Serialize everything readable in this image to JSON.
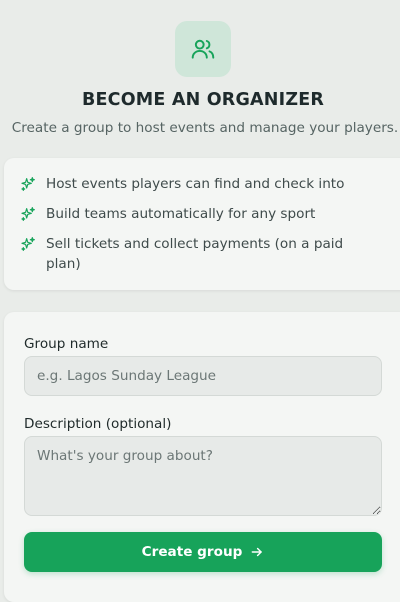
{
  "header": {
    "icon": "users-icon",
    "title": "BECOME AN ORGANIZER",
    "subtitle": "Create a group to host events and manage your players."
  },
  "features": {
    "icon": "sparkles-icon",
    "items": [
      {
        "text": "Host events players can find and check into"
      },
      {
        "text": "Build teams automatically for any sport"
      },
      {
        "text": "Sell tickets and collect payments (on a paid plan)"
      }
    ]
  },
  "form": {
    "group_name": {
      "label": "Group name",
      "placeholder": "e.g. Lagos Sunday League",
      "value": ""
    },
    "description": {
      "label": "Description (optional)",
      "placeholder": "What's your group about?",
      "value": ""
    },
    "submit": {
      "label": "Create group",
      "icon": "arrow-right-icon"
    }
  },
  "colors": {
    "accent": "#17a35a",
    "icon_tile": "#cfe6d9",
    "background": "#e9ece9",
    "card": "#f4f6f4"
  }
}
